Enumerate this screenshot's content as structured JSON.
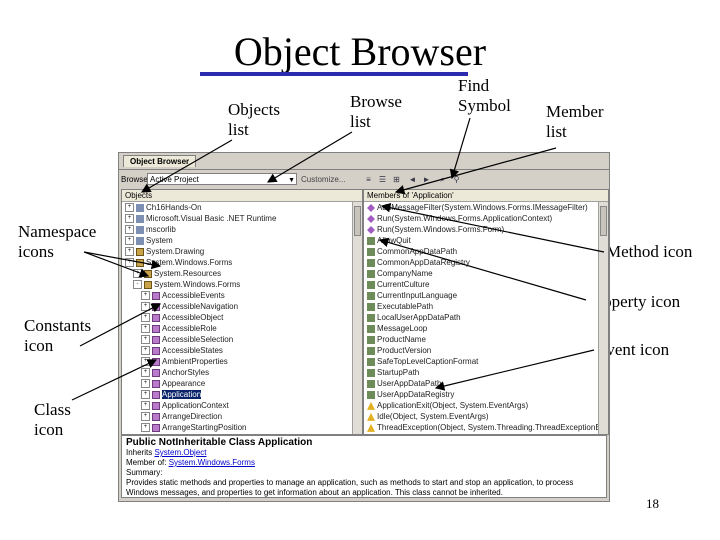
{
  "slide": {
    "title": "Object Browser",
    "page_number": "18"
  },
  "callouts": {
    "objects_list": [
      "Objects",
      "list"
    ],
    "browse_list": [
      "Browse",
      "list"
    ],
    "find_symbol": [
      "Find",
      "Symbol"
    ],
    "member_list": [
      "Member",
      "list"
    ],
    "namespace_icons": [
      "Namespace",
      "icons"
    ],
    "method_icon": "Method icon",
    "property_icon": "Property icon",
    "constants_icon": [
      "Constants",
      "icon"
    ],
    "event_icon": "Event icon",
    "class_icon": [
      "Class",
      "icon"
    ]
  },
  "window": {
    "tab": "Object Browser",
    "browse_label": "Browse:",
    "browse_value": "Active Project",
    "customize": "Customize...",
    "objects_header": "Objects",
    "members_header": "Members of 'Application'"
  },
  "objects": [
    {
      "exp": "+",
      "icon": "asm",
      "indent": 0,
      "text": "Ch16Hands-On"
    },
    {
      "exp": "+",
      "icon": "asm",
      "indent": 0,
      "text": "Microsoft.Visual Basic .NET Runtime"
    },
    {
      "exp": "+",
      "icon": "asm",
      "indent": 0,
      "text": "mscorlib"
    },
    {
      "exp": "+",
      "icon": "asm",
      "indent": 0,
      "text": "System"
    },
    {
      "exp": "+",
      "icon": "ns",
      "indent": 0,
      "text": "System.Drawing"
    },
    {
      "exp": "+",
      "icon": "ns",
      "indent": 0,
      "text": "System.Windows.Forms"
    },
    {
      "exp": "+",
      "icon": "ns",
      "indent": 1,
      "text": "System.Resources"
    },
    {
      "exp": "-",
      "icon": "ns",
      "indent": 1,
      "text": "System.Windows.Forms"
    },
    {
      "exp": "+",
      "icon": "class",
      "indent": 2,
      "text": "AccessibleEvents"
    },
    {
      "exp": "+",
      "icon": "class",
      "indent": 2,
      "text": "AccessibleNavigation"
    },
    {
      "exp": "+",
      "icon": "class",
      "indent": 2,
      "text": "AccessibleObject"
    },
    {
      "exp": "+",
      "icon": "class",
      "indent": 2,
      "text": "AccessibleRole"
    },
    {
      "exp": "+",
      "icon": "class",
      "indent": 2,
      "text": "AccessibleSelection"
    },
    {
      "exp": "+",
      "icon": "class",
      "indent": 2,
      "text": "AccessibleStates"
    },
    {
      "exp": "+",
      "icon": "class",
      "indent": 2,
      "text": "AmbientProperties"
    },
    {
      "exp": "+",
      "icon": "class",
      "indent": 2,
      "text": "AnchorStyles"
    },
    {
      "exp": "+",
      "icon": "class",
      "indent": 2,
      "text": "Appearance"
    },
    {
      "exp": "+",
      "icon": "class",
      "indent": 2,
      "text": "Application",
      "selected": true
    },
    {
      "exp": "+",
      "icon": "class",
      "indent": 2,
      "text": "ApplicationContext"
    },
    {
      "exp": "+",
      "icon": "class",
      "indent": 2,
      "text": "ArrangeDirection"
    },
    {
      "exp": "+",
      "icon": "class",
      "indent": 2,
      "text": "ArrangeStartingPosition"
    }
  ],
  "members": [
    {
      "icon": "method",
      "text": "AddMessageFilter(System.Windows.Forms.IMessageFilter)"
    },
    {
      "icon": "method",
      "text": "Run(System.Windows.Forms.ApplicationContext)"
    },
    {
      "icon": "method",
      "text": "Run(System.Windows.Forms.Form)"
    },
    {
      "icon": "prop",
      "text": "AllowQuit"
    },
    {
      "icon": "prop",
      "text": "CommonAppDataPath"
    },
    {
      "icon": "prop",
      "text": "CommonAppDataRegistry"
    },
    {
      "icon": "prop",
      "text": "CompanyName"
    },
    {
      "icon": "prop",
      "text": "CurrentCulture"
    },
    {
      "icon": "prop",
      "text": "CurrentInputLanguage"
    },
    {
      "icon": "prop",
      "text": "ExecutablePath"
    },
    {
      "icon": "prop",
      "text": "LocalUserAppDataPath"
    },
    {
      "icon": "prop",
      "text": "MessageLoop"
    },
    {
      "icon": "prop",
      "text": "ProductName"
    },
    {
      "icon": "prop",
      "text": "ProductVersion"
    },
    {
      "icon": "prop",
      "text": "SafeTopLevelCaptionFormat"
    },
    {
      "icon": "prop",
      "text": "StartupPath"
    },
    {
      "icon": "prop",
      "text": "UserAppDataPath"
    },
    {
      "icon": "prop",
      "text": "UserAppDataRegistry"
    },
    {
      "icon": "event",
      "text": "ApplicationExit(Object, System.EventArgs)"
    },
    {
      "icon": "event",
      "text": "Idle(Object, System.EventArgs)"
    },
    {
      "icon": "event",
      "text": "ThreadException(Object, System.Threading.ThreadExceptionEventArgs)"
    }
  ],
  "description": {
    "heading": "Public NotInheritable Class Application",
    "inherits_label": "Inherits",
    "inherits_value": "System.Object",
    "member_of_label": "Member of:",
    "member_of_value": "System.Windows.Forms",
    "summary_label": "Summary:",
    "summary_text": "Provides static methods and properties to manage an application, such as methods to start and stop an application, to process Windows messages, and properties to get information about an application. This class cannot be inherited."
  },
  "colors": {
    "title_underline": "#2b2bb0",
    "selection": "#0a246a",
    "window_bg": "#d4d0c8"
  }
}
